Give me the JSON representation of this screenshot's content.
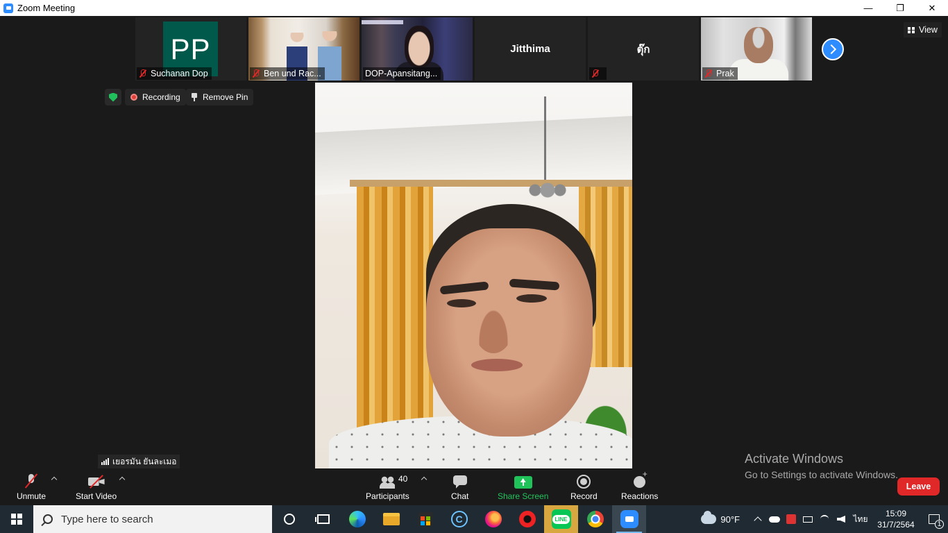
{
  "window": {
    "title": "Zoom Meeting",
    "controls": [
      "—",
      "❐",
      "✕"
    ]
  },
  "participants_strip": [
    {
      "name": "Suchanan Dop",
      "initials": "PP",
      "muted": true,
      "video": false
    },
    {
      "name": "Ben und Rac...",
      "muted": true,
      "video": true
    },
    {
      "name": "DOP-Apansitang...",
      "muted": false,
      "video": true
    },
    {
      "name": "Jitthima",
      "muted": false,
      "video": false
    },
    {
      "name": "ตุ๊ก",
      "muted": true,
      "video": false
    },
    {
      "name": "Prak",
      "muted": true,
      "video": true
    }
  ],
  "view_button": {
    "label": "View"
  },
  "status": {
    "recording_label": "Recording",
    "remove_pin_label": "Remove Pin"
  },
  "self_view": {
    "name": "เยอรมัน ยันละเมอ"
  },
  "activation": {
    "title": "Activate Windows",
    "subtitle": "Go to Settings to activate Windows."
  },
  "toolbar": {
    "unmute": "Unmute",
    "start_video": "Start Video",
    "participants": "Participants",
    "participants_count": "40",
    "chat": "Chat",
    "share_screen": "Share Screen",
    "record": "Record",
    "reactions": "Reactions",
    "leave": "Leave"
  },
  "taskbar": {
    "search_placeholder": "Type here to search",
    "line_label": "LINE",
    "weather": "90°F",
    "language": "ไทย",
    "time": "15:09",
    "date": "31/7/2564",
    "notification_count": "1"
  },
  "colors": {
    "zoom_blue": "#2d8cff",
    "leave_red": "#e02828",
    "share_green": "#22c55e",
    "avatar_green": "#00594a"
  }
}
